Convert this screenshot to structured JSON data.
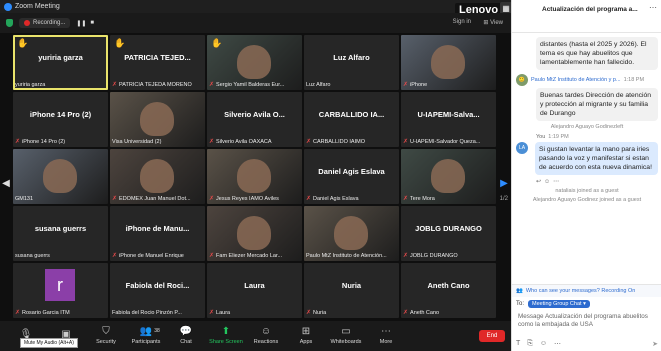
{
  "window": {
    "title": "Zoom Meeting",
    "brand_overlay": "Lenovo"
  },
  "recbar": {
    "recording_label": "Recording...",
    "sign_in": "Sign in",
    "view": "View"
  },
  "tiles": [
    {
      "name": "yuriria garza",
      "label": "yuriria garza",
      "muted": false,
      "hand": true,
      "active": true,
      "video": false
    },
    {
      "name": "PATRICIA TEJED...",
      "label": "PATRICIA TEJEDA MORENO",
      "muted": true,
      "hand": true,
      "active": false,
      "video": false
    },
    {
      "name": "",
      "label": "Sergio Yamil Balderas Eur...",
      "muted": true,
      "hand": true,
      "active": false,
      "video": true
    },
    {
      "name": "Luz Alfaro",
      "label": "Luz Alfaro",
      "muted": false,
      "hand": false,
      "active": false,
      "video": false
    },
    {
      "name": "",
      "label": "iPhone",
      "muted": true,
      "hand": false,
      "active": false,
      "video": true
    },
    {
      "name": "iPhone 14 Pro (2)",
      "label": "iPhone 14 Pro (2)",
      "muted": true,
      "hand": false,
      "active": false,
      "video": false
    },
    {
      "name": "",
      "label": "Visa Universidad (2)",
      "muted": false,
      "hand": false,
      "active": false,
      "video": true
    },
    {
      "name": "Silverio Avila O...",
      "label": "Silverio Avila OAXACA",
      "muted": true,
      "hand": false,
      "active": false,
      "video": false
    },
    {
      "name": "CARBALLIDO IA...",
      "label": "CARBALLIDO IAIMO",
      "muted": true,
      "hand": false,
      "active": false,
      "video": false
    },
    {
      "name": "U-IAPEMI-Salva...",
      "label": "U-IAPEMI-Salvador Queza...",
      "muted": true,
      "hand": false,
      "active": false,
      "video": false
    },
    {
      "name": "",
      "label": "GM131",
      "muted": false,
      "hand": false,
      "active": false,
      "video": true
    },
    {
      "name": "",
      "label": "EDOMEX Juan Manuel Dot...",
      "muted": true,
      "hand": false,
      "active": false,
      "video": true
    },
    {
      "name": "",
      "label": "Jesus Reyes IAMO Aviles",
      "muted": true,
      "hand": false,
      "active": false,
      "video": true
    },
    {
      "name": "Daniel Agis Eslava",
      "label": "Daniel Agis Eslava",
      "muted": true,
      "hand": false,
      "active": false,
      "video": false
    },
    {
      "name": "",
      "label": "Tere Mora",
      "muted": true,
      "hand": false,
      "active": false,
      "video": true
    },
    {
      "name": "susana guerrs",
      "label": "susana guerrs",
      "muted": false,
      "hand": false,
      "active": false,
      "video": false
    },
    {
      "name": "iPhone de Manu...",
      "label": "iPhone de Manuel Enrique",
      "muted": true,
      "hand": false,
      "active": false,
      "video": false
    },
    {
      "name": "",
      "label": "Fam Eliezer Mercado Lar...",
      "muted": true,
      "hand": false,
      "active": false,
      "video": true
    },
    {
      "name": "",
      "label": "Paulo MtZ Instituto de Atención...",
      "muted": false,
      "hand": false,
      "active": false,
      "video": true
    },
    {
      "name": "JOBLG DURANGO",
      "label": "JOBLG DURANGO",
      "muted": true,
      "hand": false,
      "active": false,
      "video": false
    },
    {
      "name": "",
      "label": "Rosario Garcia ITM",
      "muted": true,
      "hand": false,
      "active": false,
      "video": true,
      "initial": "r"
    },
    {
      "name": "Fabiola del Roci...",
      "label": "Fabiola del Rocio Pinzón P...",
      "muted": false,
      "hand": false,
      "active": false,
      "video": false
    },
    {
      "name": "Laura",
      "label": "Laura",
      "muted": true,
      "hand": false,
      "active": false,
      "video": false
    },
    {
      "name": "Nuria",
      "label": "Nuria",
      "muted": true,
      "hand": false,
      "active": false,
      "video": false
    },
    {
      "name": "Aneth Cano",
      "label": "Aneth Cano",
      "muted": true,
      "hand": false,
      "active": false,
      "video": false
    }
  ],
  "pager": "1/2",
  "toolbar": {
    "items": [
      {
        "label": "",
        "icon": "mic-icon"
      },
      {
        "label": "",
        "icon": "video-icon"
      },
      {
        "label": "Security",
        "icon": "shield-icon"
      },
      {
        "label": "Participants",
        "icon": "participants-icon",
        "count": "38"
      },
      {
        "label": "Chat",
        "icon": "chat-icon"
      },
      {
        "label": "Share Screen",
        "icon": "share-screen-icon"
      },
      {
        "label": "Reactions",
        "icon": "reactions-icon"
      },
      {
        "label": "Apps",
        "icon": "apps-icon"
      },
      {
        "label": "Whiteboards",
        "icon": "whiteboard-icon"
      },
      {
        "label": "More",
        "icon": "more-icon"
      }
    ],
    "end_label": "End",
    "tooltip": "Mute My Audio (Alt+A)"
  },
  "chat": {
    "title": "Actualización del programa a...",
    "msg1": "distantes (hasta el 2025 y 2026). El tema es que hay abuelitos que lamentablemente han fallecido.",
    "sender2": "Paulo MtZ Instituto de Atención y p...",
    "time2": "1:18 PM",
    "msg2": "Buenas tardes Dirección de atención y protección al migrante y su familia  de Durango",
    "sys1": "Alejandro Aguayo Godinezleft",
    "sender3": "You",
    "time3": "1:19 PM",
    "msg3": "Si gustan levantar la mano para iries pasando la voz y manifestar si estan de acuerdo con esta nueva dinamica!",
    "sys2": "nataliais joined as a guest",
    "sys3": "Alejandro Aguayo Godinez joined as a guest",
    "who_can_see": "Who can see your messages? Recording On",
    "to_label": "To:",
    "to_target": "Meeting Group Chat",
    "draft": "Message Actualización del programa abuelitos como la embajada de USA"
  }
}
